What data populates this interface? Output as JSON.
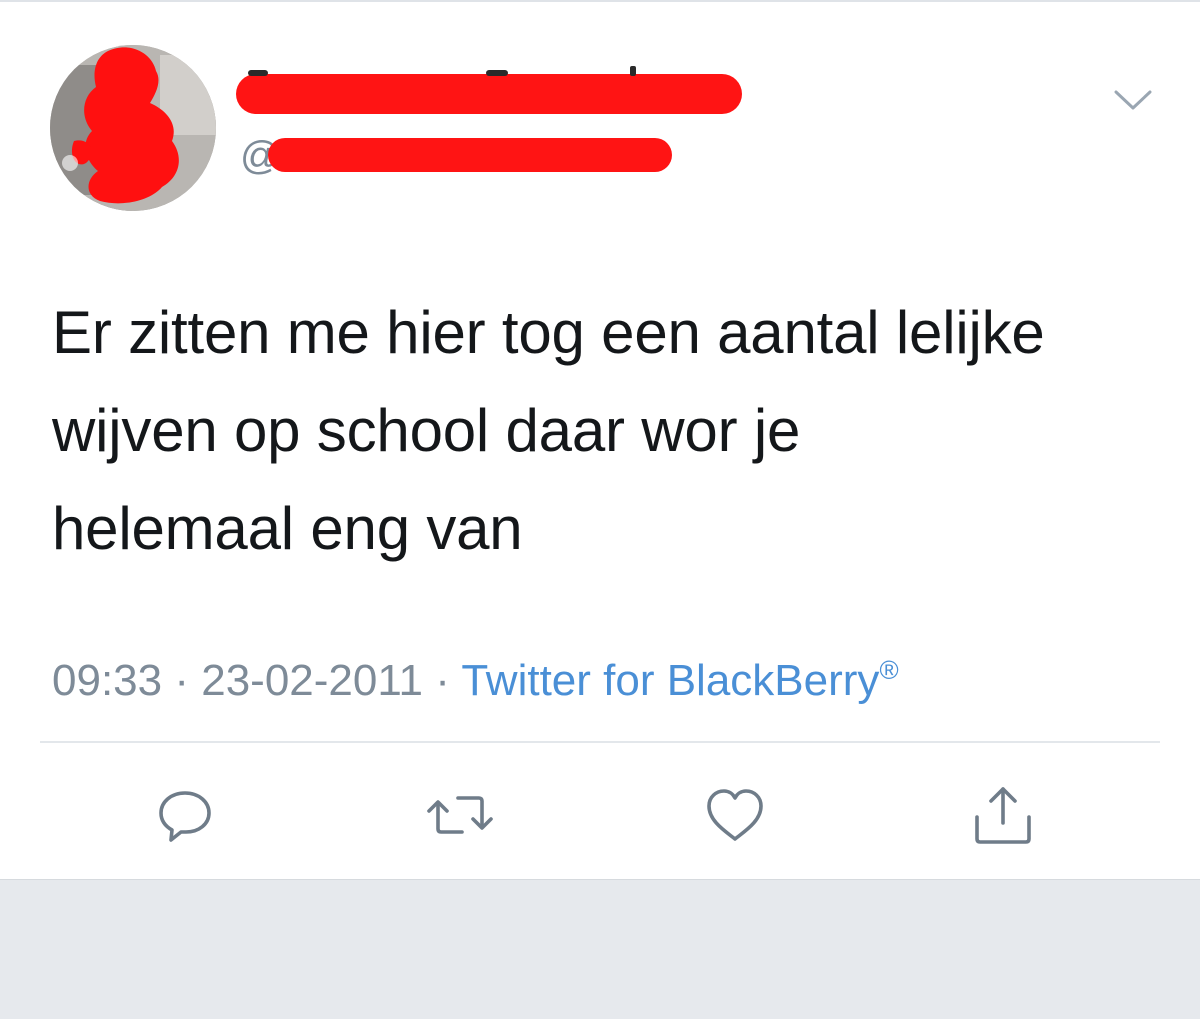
{
  "tweet": {
    "author": {
      "handle_prefix": "@"
    },
    "text_lines": [
      "Er zitten me hier tog een aantal lelijke",
      "wijven op school daar wor je",
      "helemaal eng van"
    ],
    "time": "09:33",
    "separator": " · ",
    "date": "23-02-2011",
    "source": "Twitter for BlackBerry",
    "source_mark": "®"
  },
  "icons": {
    "menu": "chevron-down-icon",
    "reply": "reply-icon",
    "retweet": "retweet-icon",
    "like": "heart-icon",
    "share": "share-icon"
  },
  "colors": {
    "text": "#14171a",
    "muted": "#7e8b98",
    "link": "#4a8fd6",
    "redaction": "#ff1414",
    "footer_bg": "#e6e9ed"
  }
}
